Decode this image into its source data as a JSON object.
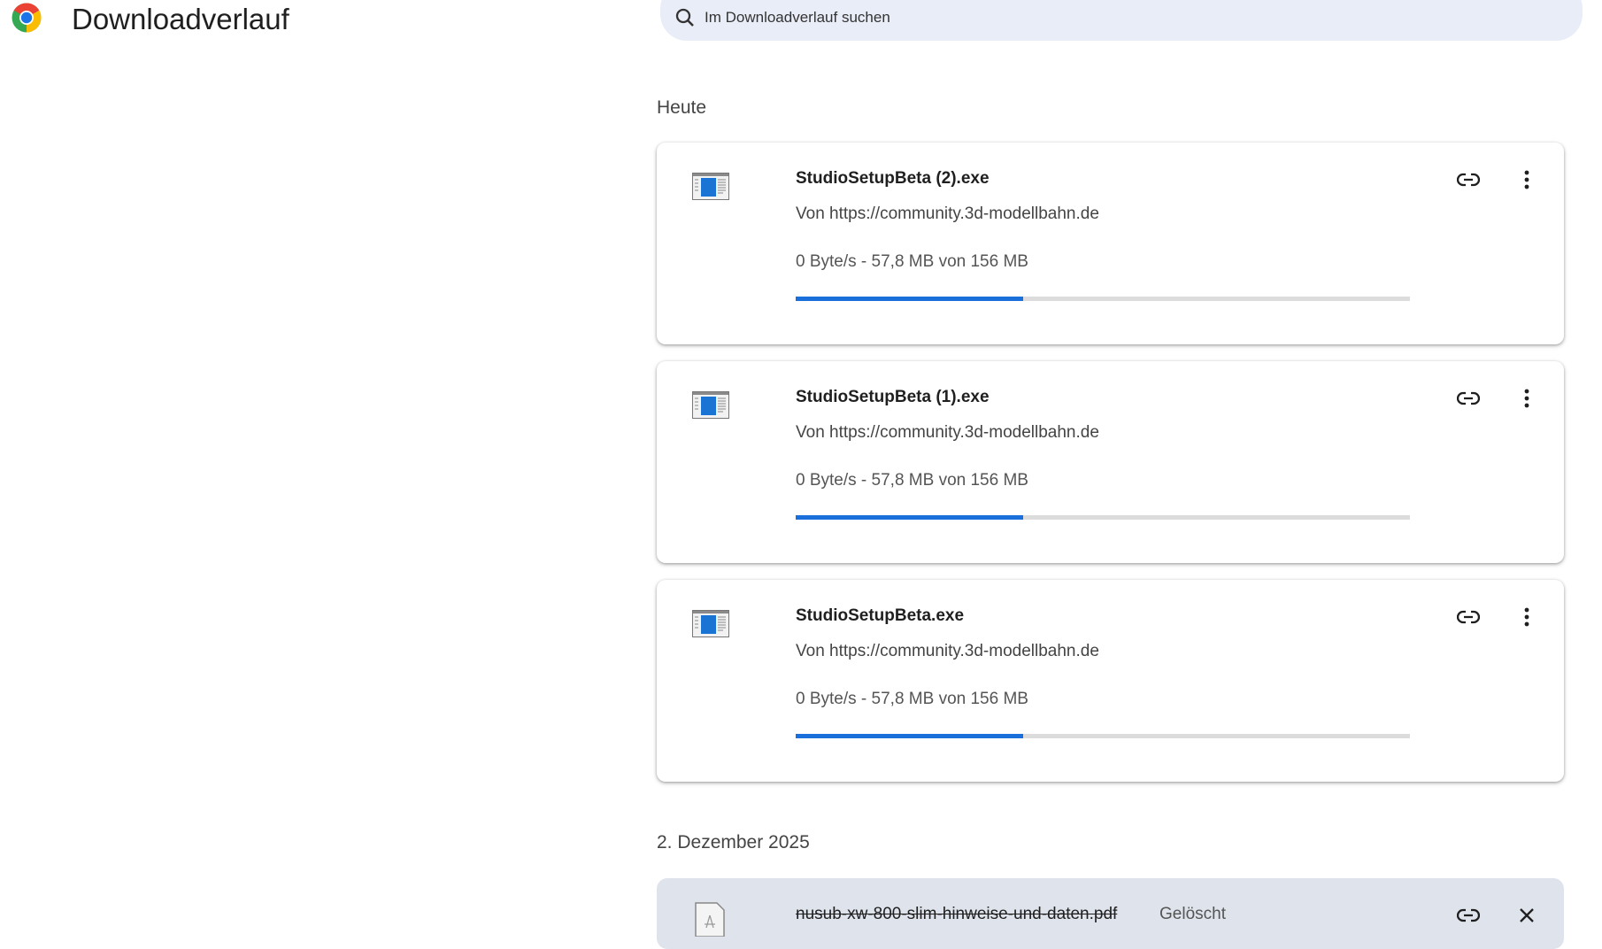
{
  "header": {
    "title": "Downloadverlauf",
    "search_placeholder": "Im Downloadverlauf suchen"
  },
  "sections": [
    {
      "label": "Heute",
      "items": [
        {
          "filename": "StudioSetupBeta (2).exe",
          "source": "Von https://community.3d-modellbahn.de",
          "status": "0 Byte/s - 57,8 MB von 156 MB",
          "progress_percent": 37
        },
        {
          "filename": "StudioSetupBeta (1).exe",
          "source": "Von https://community.3d-modellbahn.de",
          "status": "0 Byte/s - 57,8 MB von 156 MB",
          "progress_percent": 37
        },
        {
          "filename": "StudioSetupBeta.exe",
          "source": "Von https://community.3d-modellbahn.de",
          "status": "0 Byte/s - 57,8 MB von 156 MB",
          "progress_percent": 37
        }
      ]
    },
    {
      "label": "2. Dezember 2025",
      "items": [
        {
          "filename": "nusub-xw-800-slim-hinweise-und-daten.pdf",
          "state": "Gelöscht"
        }
      ]
    }
  ],
  "colors": {
    "accent": "#1a6fdb",
    "search_bg": "#e9edf7",
    "deleted_bg": "#dfe4ec"
  }
}
